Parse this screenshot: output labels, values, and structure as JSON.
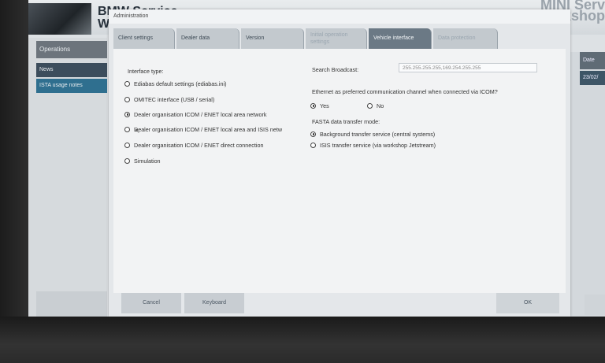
{
  "app": {
    "brand_line1": "BMW Service",
    "brand_line2": "W",
    "mini_line1": "MINI Serv",
    "mini_line2": "kshop"
  },
  "left_nav": {
    "operations": "Operations",
    "news": "News",
    "ista_notes": "ISTA usage notes"
  },
  "right_panel": {
    "date_header": "Date",
    "date_value": "23/02/"
  },
  "dialog": {
    "title": "Administration",
    "tabs": [
      {
        "label": "Client settings",
        "state": "normal"
      },
      {
        "label": "Dealer data",
        "state": "normal"
      },
      {
        "label": "Version",
        "state": "normal"
      },
      {
        "label_line1": "Initial operation",
        "label_line2": "settings",
        "state": "disabled"
      },
      {
        "label": "Vehicle interface",
        "state": "active"
      },
      {
        "label": "Data protection",
        "state": "disabled"
      }
    ],
    "interface_type_label": "Interface type:",
    "interface_options": [
      {
        "label": "Ediabas default settings (ediabas.ini)",
        "checked": false
      },
      {
        "label": "OMITEC interface (USB / serial)",
        "checked": false
      },
      {
        "label": "Dealer organisation ICOM / ENET local area network",
        "checked": true
      },
      {
        "label": "Dealer organisation ICOM / ENET local area and ISIS netw",
        "checked": false
      },
      {
        "label": "Dealer organisation ICOM / ENET direct connection",
        "checked": false
      },
      {
        "label": "Simulation",
        "checked": false
      }
    ],
    "search_broadcast_label": "Search Broadcast:",
    "search_broadcast_value": "255.255.255.255,169.254.255.255",
    "ethernet_label": "Ethernet as preferred communication channel when connected via ICOM?",
    "ethernet_yes": "Yes",
    "ethernet_no": "No",
    "fasta_label": "FASTA data transfer mode:",
    "fasta_options": [
      {
        "label": "Background transfer service (central systems)",
        "checked": true
      },
      {
        "label": "ISIS transfer service (via workshop Jetstream)",
        "checked": false
      }
    ],
    "cancel_label": "Cancel",
    "keyboard_label": "Keyboard",
    "ok_label": "OK"
  }
}
